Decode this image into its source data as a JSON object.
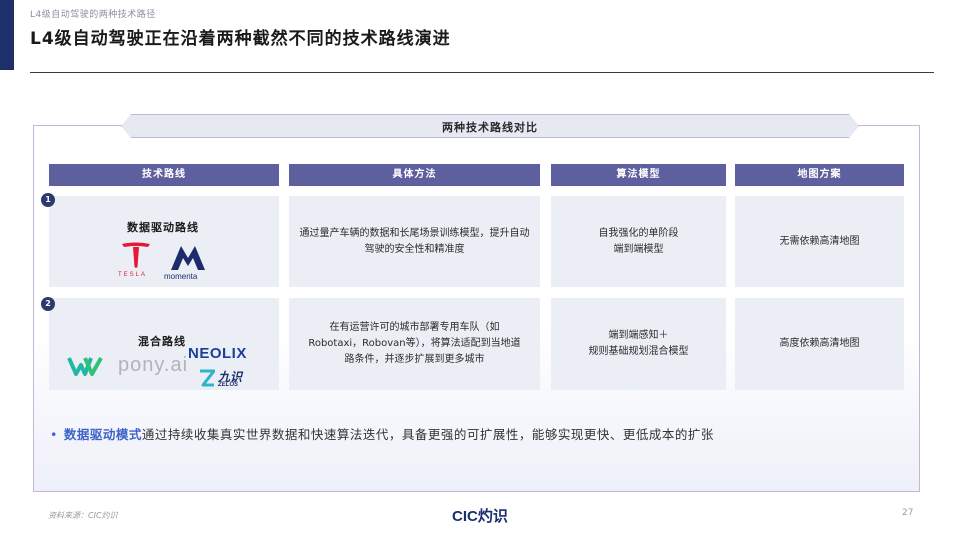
{
  "header": {
    "breadcrumb": "L4级自动驾驶的两种技术路径",
    "title": "L4级自动驾驶正在沿着两种截然不同的技术路线演进"
  },
  "table": {
    "banner": "两种技术路线对比",
    "columns": [
      "技术路线",
      "具体方法",
      "算法模型",
      "地图方案"
    ],
    "rows": [
      {
        "badge": "1",
        "route": "数据驱动路线",
        "logos": [
          "TESLA",
          "momenta"
        ],
        "method": "通过量产车辆的数据和长尾场景训练模型，提升自动驾驶的安全性和精准度",
        "algorithm_line1": "自我强化的单阶段",
        "algorithm_line2": "端到端模型",
        "map": "无需依赖高清地图"
      },
      {
        "badge": "2",
        "route": "混合路线",
        "logos": [
          "pony.ai",
          "NEOLIX",
          "ZELOS",
          "九识"
        ],
        "method": "在有运营许可的城市部署专用车队（如Robotaxi，Robovan等），将算法适配到当地道路条件，并逐步扩展到更多城市",
        "algorithm_line1": "端到端感知＋",
        "algorithm_line2": "规则基础规划混合模型",
        "map": "高度依赖高清地图"
      }
    ]
  },
  "summary": {
    "highlight": "数据驱动模式",
    "text": "通过持续收集真实世界数据和快速算法迭代，具备更强的可扩展性，能够实现更快、更低成本的扩张"
  },
  "footer": {
    "source": "资料来源：CIC灼识",
    "brand": "CIC灼识",
    "page": "27"
  },
  "colors": {
    "header_fill": "#5d5f9e",
    "cell_fill": "#eceef5",
    "accent": "#3c63c9",
    "brand_navy": "#1f2f6b"
  }
}
